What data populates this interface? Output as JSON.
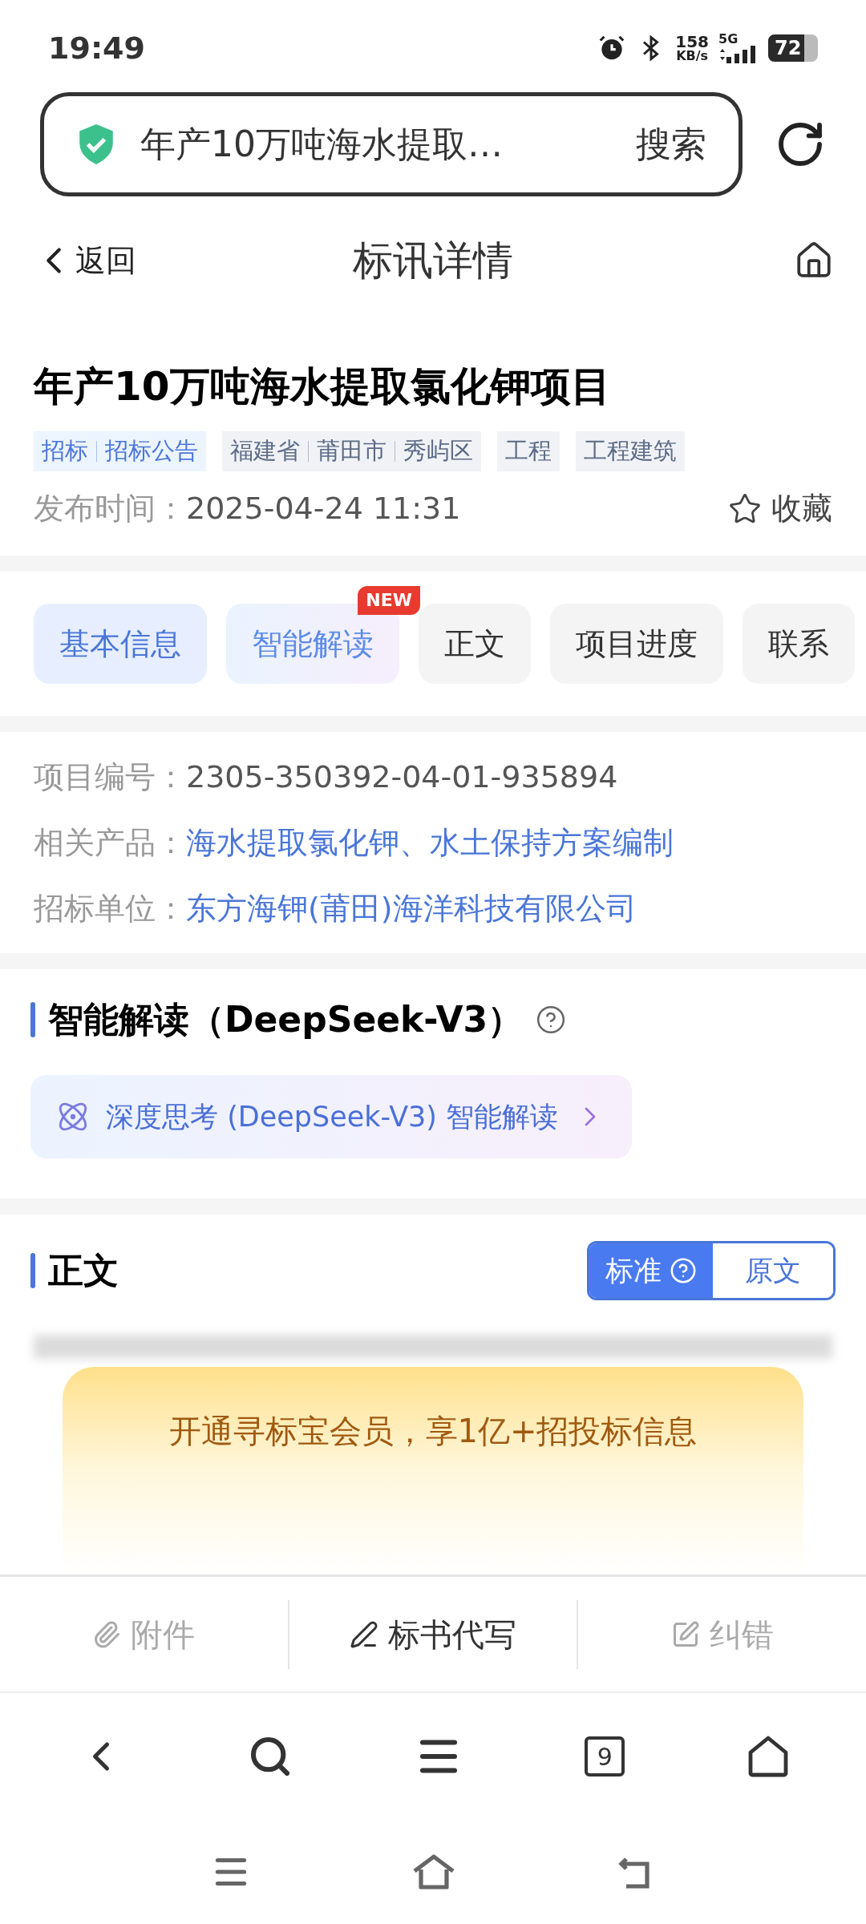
{
  "status_bar": {
    "time": "19:49",
    "network_speed": "158",
    "speed_unit": "KB/s",
    "network": "5G",
    "battery": "72"
  },
  "address_bar": {
    "query": "年产10万吨海水提取…",
    "button": "搜索"
  },
  "header": {
    "back": "返回",
    "title": "标讯详情"
  },
  "project": {
    "title": "年产10万吨海水提取氯化钾项目",
    "tags": [
      {
        "kind": "type",
        "parts": [
          "招标",
          "招标公告"
        ]
      },
      {
        "kind": "region",
        "parts": [
          "福建省",
          "莆田市",
          "秀屿区"
        ]
      },
      {
        "kind": "region",
        "parts": [
          "工程"
        ]
      },
      {
        "kind": "region",
        "parts": [
          "工程建筑"
        ]
      }
    ],
    "publish_label": "发布时间：",
    "publish_time": "2025-04-24 11:31",
    "favorite": "收藏"
  },
  "tabs": [
    {
      "label": "基本信息",
      "selected": true,
      "kind": "normal"
    },
    {
      "label": "智能解读",
      "selected": false,
      "kind": "ai",
      "badge": "NEW"
    },
    {
      "label": "正文",
      "selected": false,
      "kind": "normal"
    },
    {
      "label": "项目进度",
      "selected": false,
      "kind": "normal"
    },
    {
      "label": "联系",
      "selected": false,
      "kind": "normal"
    }
  ],
  "info": [
    {
      "label": "项目编号：",
      "value": "2305-350392-04-01-935894",
      "link": false
    },
    {
      "label": "相关产品：",
      "value": "海水提取氯化钾、水土保持方案编制",
      "link": true
    },
    {
      "label": "招标单位：",
      "value": "东方海钾(莆田)海洋科技有限公司",
      "link": true
    }
  ],
  "ai_section": {
    "title": "智能解读（DeepSeek-V3）",
    "deep_think": "深度思考 (DeepSeek-V3) 智能解读"
  },
  "body_section": {
    "title": "正文",
    "modes": [
      {
        "label": "标准",
        "selected": true
      },
      {
        "label": "原文",
        "selected": false
      }
    ]
  },
  "promo": {
    "text": "开通寻标宝会员，享1亿+招投标信息"
  },
  "actions": [
    {
      "kind": "attachment",
      "label": "附件",
      "disabled": true
    },
    {
      "kind": "write",
      "label": "标书代写",
      "disabled": false
    },
    {
      "kind": "correct",
      "label": "纠错",
      "disabled": true
    }
  ],
  "browser_nav": {
    "tab_count": "9"
  }
}
